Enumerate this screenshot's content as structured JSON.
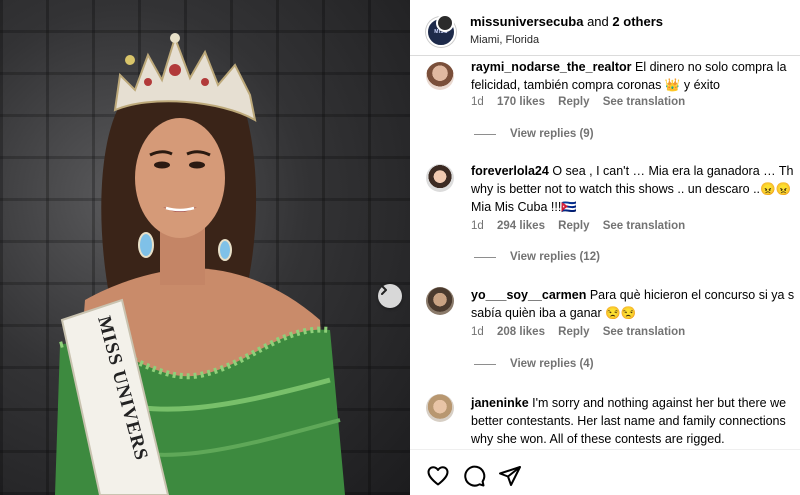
{
  "post": {
    "username": "missuniversecuba",
    "and_text": "and",
    "others": "2 others",
    "location": "Miami, Florida",
    "avatar_text": "MISS"
  },
  "photo": {
    "sash_text": "MISS UNIVERS",
    "next_icon": "chevron-right-icon"
  },
  "comments": [
    {
      "username": "raymi_nodarse_the_realtor",
      "line1": "El dinero no solo compra la",
      "line2": "felicidad, también compra coronas 👑 y éxito",
      "line3": "",
      "time": "1d",
      "likes": "170 likes",
      "reply": "Reply",
      "translation": "See translation",
      "view_replies": "View replies (9)"
    },
    {
      "username": "foreverlola24",
      "line1": "O sea , I can't … Mia era la ganadora … Th",
      "line2": "why is better not to watch this shows .. un descaro ..😠😠",
      "line3": "Mia Mis Cuba !!!🇨🇺",
      "time": "1d",
      "likes": "294 likes",
      "reply": "Reply",
      "translation": "See translation",
      "view_replies": "View replies (12)"
    },
    {
      "username": "yo___soy__carmen",
      "line1": "Para què hicieron el concurso si ya s",
      "line2": "sabía quièn iba a ganar 😒😒",
      "line3": "",
      "time": "1d",
      "likes": "208 likes",
      "reply": "Reply",
      "translation": "See translation",
      "view_replies": "View replies (4)"
    },
    {
      "username": "janeninke",
      "line1": "I'm sorry and nothing against her but there we",
      "line2": "better contestants. Her last name and family connections",
      "line3": "why she won. All of these contests are rigged.",
      "time": "",
      "likes": "",
      "reply": "",
      "translation": "",
      "view_replies": ""
    }
  ],
  "actions": {
    "like_icon": "heart-icon",
    "comment_icon": "comment-icon",
    "share_icon": "share-icon"
  },
  "colors": {
    "muted_text": "#737373",
    "divider": "#dbdbdb",
    "gown_green": "#3d8a3f"
  }
}
